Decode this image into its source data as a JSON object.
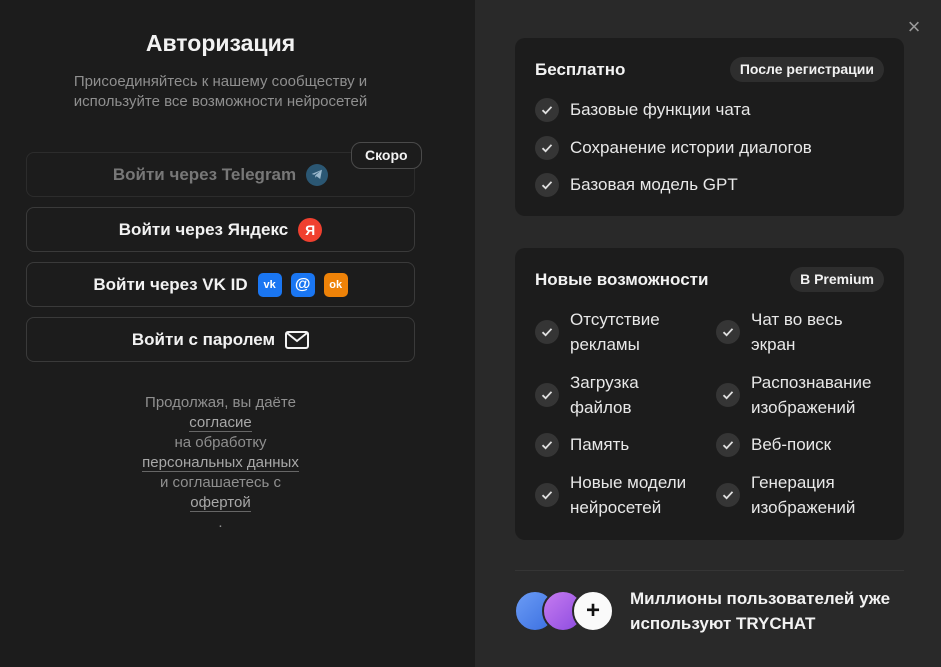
{
  "auth": {
    "title": "Авторизация",
    "subtitle": "Присоединяйтесь к нашему сообществу и используйте все возможности нейросетей",
    "buttons": [
      {
        "label": "Войти через Telegram",
        "icon": "telegram-icon",
        "disabled": true
      },
      {
        "label": "Войти через Яндекс",
        "icon": "yandex-icon",
        "glyph": "Я"
      },
      {
        "label": "Войти через VK ID",
        "icons": [
          "vk-icon",
          "mail-ru-icon",
          "odnoklassniki-icon"
        ],
        "glyphs": [
          "vk",
          "@",
          "ok"
        ]
      },
      {
        "label": "Войти с паролем",
        "icon": "envelope-icon"
      }
    ],
    "soon_badge": "Скоро",
    "consent": {
      "line1": "Продолжая, вы даёте",
      "link1": "согласие",
      "line2": "на обработку",
      "link2": "персональных данных",
      "line3": "и соглашаетесь с",
      "link3": "офертой",
      "end": "."
    }
  },
  "close_label": "×",
  "free": {
    "title": "Бесплатно",
    "badge": "После регистрации",
    "features": [
      "Базовые функции чата",
      "Сохранение истории диалогов",
      "Базовая модель GPT"
    ]
  },
  "premium": {
    "title": "Новые возможности",
    "badge": "В Premium",
    "features": [
      [
        "Отсутствие",
        "рекламы"
      ],
      [
        "Чат во весь",
        "экран"
      ],
      [
        "Загрузка",
        "файлов"
      ],
      [
        "Распознавание",
        "изображений"
      ],
      [
        "Память"
      ],
      [
        "Веб-поиск"
      ],
      [
        "Новые модели",
        "нейросетей"
      ],
      [
        "Генерация",
        "изображений"
      ]
    ]
  },
  "footer": {
    "plus": "+",
    "text_line1": "Миллионы пользователей уже",
    "text_line2": "используют TRYCHAT"
  },
  "colors": {
    "left_bg": "#1c1c1c",
    "right_bg": "#292929",
    "card_bg": "#1c1c1c",
    "yandex": "#f0402f",
    "vk": "#1a76f2",
    "ok": "#ee8208",
    "telegram": "#2b5773"
  }
}
